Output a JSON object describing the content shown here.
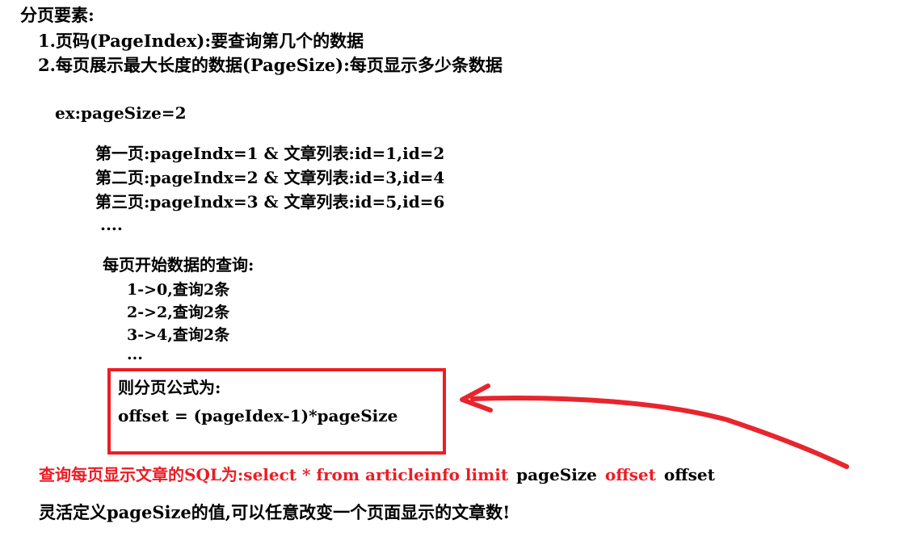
{
  "document": {
    "title_line": "分页要素:",
    "elements": [
      "1.页码(PageIndex):要查询第几个的数据",
      "2.每页展示最大长度的数据(PageSize):每页显示多少条数据"
    ],
    "example_label": "ex:pageSize=2",
    "page_examples": [
      "第一页:pageIndx=1 & 文章列表:id=1,id=2",
      "第二页:pageIndx=2 & 文章列表:id=3,id=4",
      "第三页:pageIndx=3 & 文章列表:id=5,id=6"
    ],
    "page_examples_ellipsis": "....",
    "start_query_heading": "每页开始数据的查询:",
    "start_query_rows": [
      "1->0,查询2条",
      "2->2,查询2条",
      "3->4,查询2条"
    ],
    "start_query_ellipsis": "...",
    "formula_box": {
      "heading": "则分页公式为:",
      "expression": "offset = (pageIdex-1)*pageSize",
      "border_color": "#ED1C24"
    },
    "sql_line": {
      "prefix_red": "查询每页显示文章的SQL为:select * from articleinfo limit",
      "param_black": "pageSize",
      "keyword_red": "offset",
      "value_black": "offset"
    },
    "closing_line": "灵活定义pageSize的值,可以任意改变一个页面显示的文章数!",
    "annotation": {
      "arrow_color": "#E8252D",
      "arrow_name": "curved-arrow-pointing-left"
    }
  }
}
